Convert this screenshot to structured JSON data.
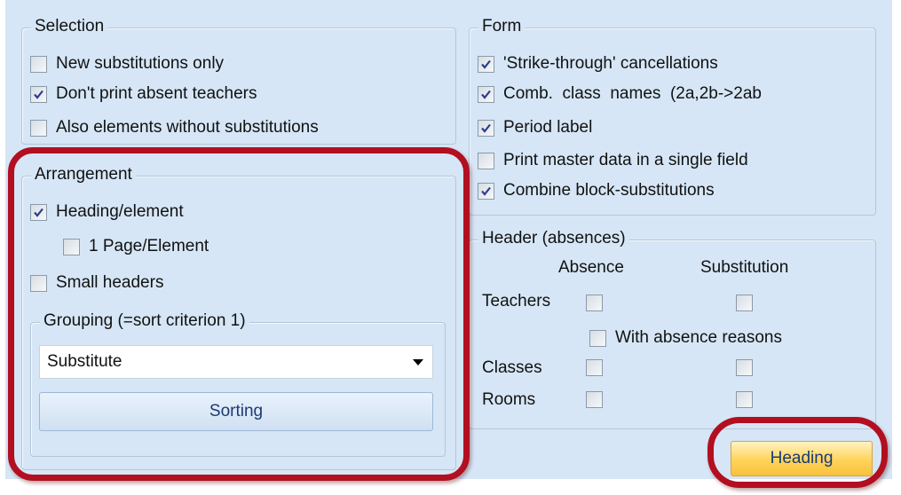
{
  "selection": {
    "title": "Selection",
    "items": [
      {
        "label": "New substitutions only",
        "checked": false
      },
      {
        "label": "Don't print absent teachers",
        "checked": true
      },
      {
        "label": "Also elements without substitutions",
        "checked": false
      }
    ]
  },
  "arrangement": {
    "title": "Arrangement",
    "heading_element": {
      "label": "Heading/element",
      "checked": true
    },
    "page_element": {
      "label": "1 Page/Element",
      "checked": false
    },
    "small_headers": {
      "label": "Small headers",
      "checked": false
    },
    "grouping": {
      "title": "Grouping (=sort criterion 1)",
      "selected": "Substitute",
      "sorting_label": "Sorting"
    }
  },
  "form": {
    "title": "Form",
    "items": [
      {
        "label": "'Strike-through' cancellations",
        "checked": true
      },
      {
        "label": "Comb.  class  names  (2a,2b->2ab",
        "checked": true
      },
      {
        "label": "Period label",
        "checked": true
      },
      {
        "label": "Print master data in a single field",
        "checked": false
      },
      {
        "label": "Combine block-substitutions",
        "checked": true
      }
    ]
  },
  "header_absences": {
    "title": "Header (absences)",
    "col_absence": "Absence",
    "col_substitution": "Substitution",
    "row_teachers": "Teachers",
    "row_classes": "Classes",
    "row_rooms": "Rooms",
    "with_absence_reasons": "With absence reasons"
  },
  "heading_button": "Heading",
  "highlight_color": "#b20f20"
}
